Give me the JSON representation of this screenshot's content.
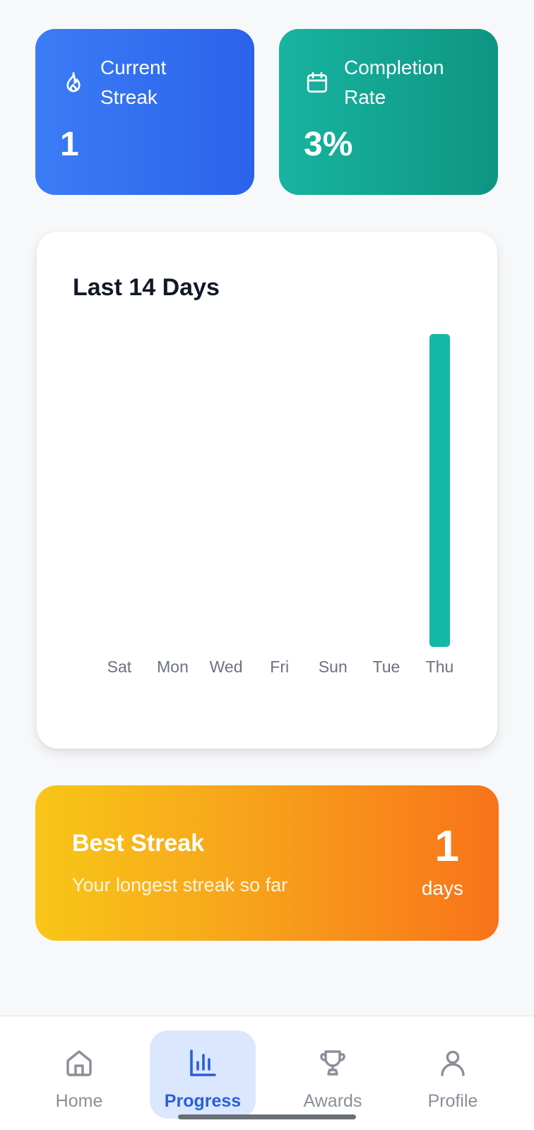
{
  "stats": {
    "streak": {
      "label_line1": "Current",
      "label_line2": "Streak",
      "value": "1",
      "icon": "flame-icon"
    },
    "completion": {
      "label_line1": "Completion",
      "label_line2": "Rate",
      "value": "3%",
      "icon": "calendar-icon"
    }
  },
  "chart": {
    "title": "Last 14 Days"
  },
  "chart_data": {
    "type": "bar",
    "title": "Last 14 Days",
    "categories": [
      "Sat",
      "Sun",
      "Mon",
      "Tue",
      "Wed",
      "Thu",
      "Fri",
      "Sat",
      "Sun",
      "Mon",
      "Tue",
      "Wed",
      "Thu"
    ],
    "tick_labels": [
      "Sat",
      "Mon",
      "Wed",
      "Fri",
      "Sun",
      "Tue",
      "Thu"
    ],
    "values": [
      0,
      0,
      0,
      0,
      0,
      0,
      0,
      0,
      0,
      0,
      0,
      0,
      1
    ],
    "ylim": [
      0,
      1
    ],
    "bar_color": "#14b8a6",
    "grid": false
  },
  "best_streak": {
    "title": "Best Streak",
    "subtitle": "Your longest streak so far",
    "value": "1",
    "unit": "days"
  },
  "nav": {
    "items": [
      {
        "label": "Home",
        "icon": "home-icon",
        "active": false
      },
      {
        "label": "Progress",
        "icon": "bar-chart-icon",
        "active": true
      },
      {
        "label": "Awards",
        "icon": "trophy-icon",
        "active": false
      },
      {
        "label": "Profile",
        "icon": "user-icon",
        "active": false
      }
    ]
  },
  "colors": {
    "primary_blue": "#2a63ea",
    "teal": "#14b8a6",
    "orange": "#f8731a",
    "active_nav_bg": "#dbe7fe"
  }
}
